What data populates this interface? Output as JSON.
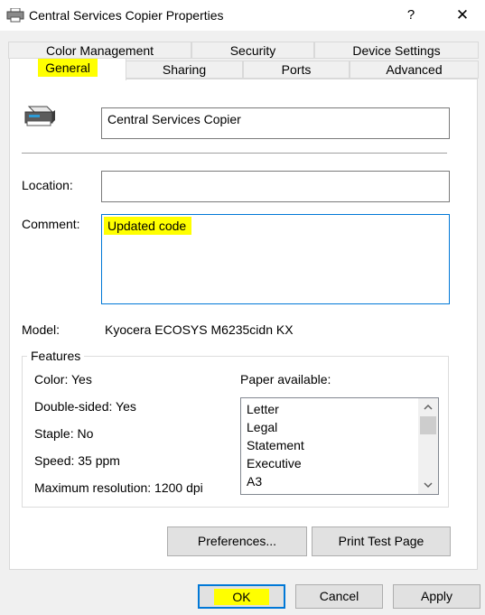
{
  "window": {
    "title": "Central Services Copier Properties",
    "help_glyph": "?",
    "close_glyph": "✕"
  },
  "tabs_back": [
    {
      "label": "Color Management"
    },
    {
      "label": "Security"
    },
    {
      "label": "Device Settings"
    }
  ],
  "tabs_front": [
    {
      "label": "General",
      "selected": true
    },
    {
      "label": "Sharing"
    },
    {
      "label": "Ports"
    },
    {
      "label": "Advanced"
    }
  ],
  "general": {
    "printer_name": "Central Services Copier",
    "location_label": "Location:",
    "location_value": "",
    "comment_label": "Comment:",
    "comment_value": "Updated code",
    "model_label": "Model:",
    "model_value": "Kyocera ECOSYS M6235cidn KX"
  },
  "features": {
    "group_title": "Features",
    "color": "Color: Yes",
    "double_sided": "Double-sided: Yes",
    "staple": "Staple: No",
    "speed": "Speed: 35 ppm",
    "max_resolution": "Maximum resolution: 1200 dpi",
    "paper_label": "Paper available:",
    "paper_sizes": [
      "Letter",
      "Legal",
      "Statement",
      "Executive",
      "A3"
    ]
  },
  "buttons": {
    "preferences": "Preferences...",
    "print_test_page": "Print Test Page",
    "ok": "OK",
    "cancel": "Cancel",
    "apply": "Apply"
  },
  "colors": {
    "highlight": "#ffff00",
    "focus_border": "#0078d7"
  }
}
